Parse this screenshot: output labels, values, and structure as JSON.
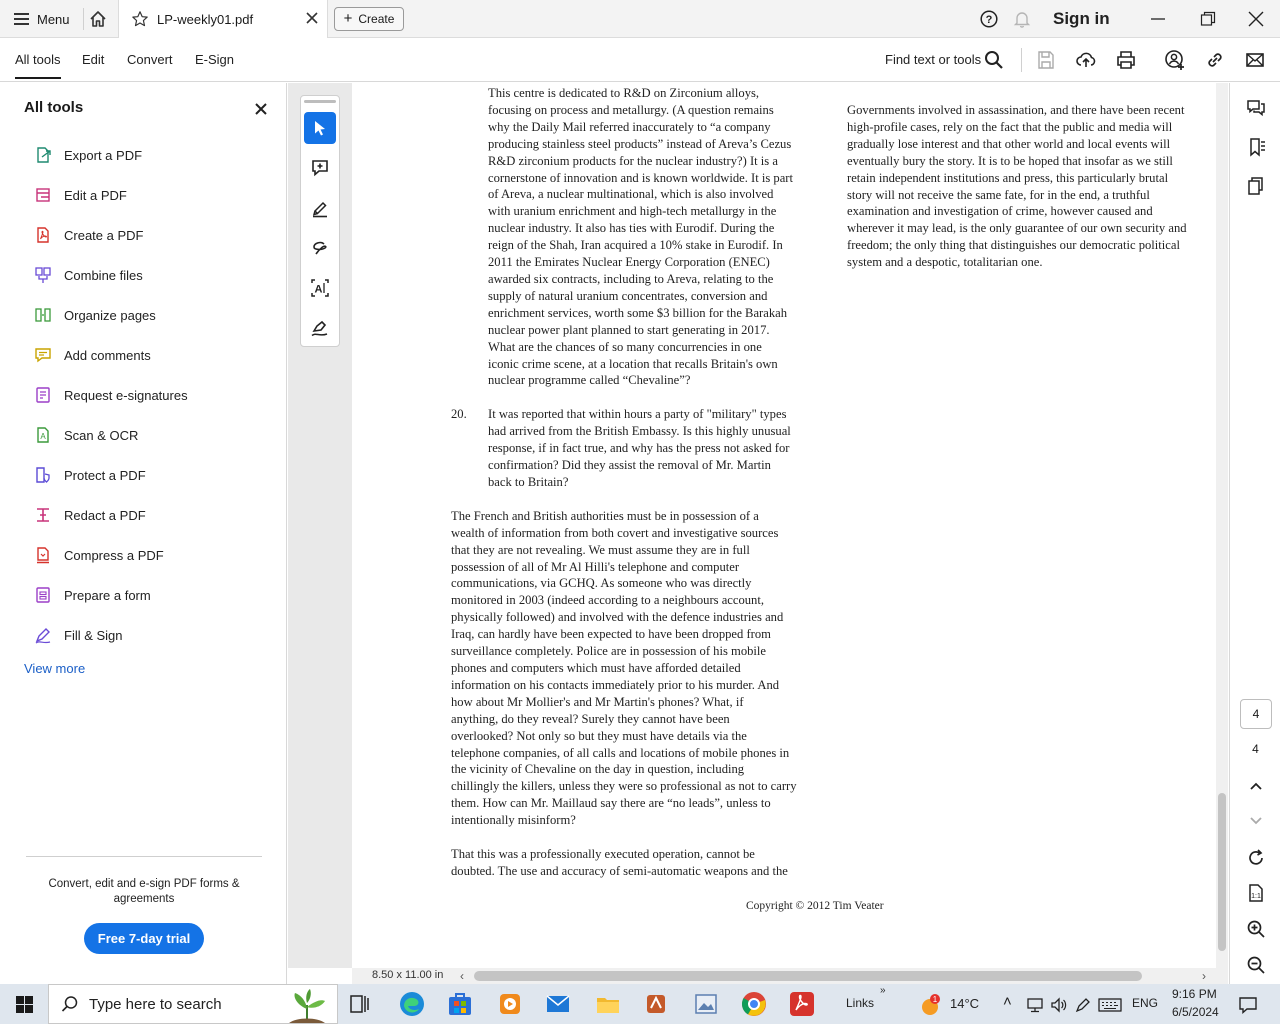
{
  "titlebar": {
    "menu_label": "Menu",
    "tab_label": "LP-weekly01.pdf",
    "create_label": "Create",
    "signin_label": "Sign in"
  },
  "toolbar": {
    "nav": [
      "All tools",
      "Edit",
      "Convert",
      "E-Sign"
    ],
    "find_label": "Find text or tools"
  },
  "leftpanel": {
    "title": "All tools",
    "tools": [
      {
        "label": "Export a PDF",
        "icon": "export-pdf-icon",
        "color": "#1f8a70"
      },
      {
        "label": "Edit a PDF",
        "icon": "edit-pdf-icon",
        "color": "#c8337a"
      },
      {
        "label": "Create a PDF",
        "icon": "create-pdf-icon",
        "color": "#d6332c"
      },
      {
        "label": "Combine files",
        "icon": "combine-files-icon",
        "color": "#6a4bd6"
      },
      {
        "label": "Organize pages",
        "icon": "organize-pages-icon",
        "color": "#3c9a3c"
      },
      {
        "label": "Add comments",
        "icon": "add-comments-icon",
        "color": "#c9a400"
      },
      {
        "label": "Request e-signatures",
        "icon": "request-esignatures-icon",
        "color": "#9b3fc7"
      },
      {
        "label": "Scan & OCR",
        "icon": "scan-ocr-icon",
        "color": "#3c9a3c"
      },
      {
        "label": "Protect a PDF",
        "icon": "protect-pdf-icon",
        "color": "#5b4bd6"
      },
      {
        "label": "Redact a PDF",
        "icon": "redact-pdf-icon",
        "color": "#c8337a"
      },
      {
        "label": "Compress a PDF",
        "icon": "compress-pdf-icon",
        "color": "#d6332c"
      },
      {
        "label": "Prepare a form",
        "icon": "prepare-form-icon",
        "color": "#9b3fc7"
      },
      {
        "label": "Fill & Sign",
        "icon": "fill-sign-icon",
        "color": "#6a4bd6"
      }
    ],
    "view_more": "View more",
    "promo_text": "Convert, edit and e-sign PDF forms & agreements",
    "trial_button": "Free 7-day trial"
  },
  "document": {
    "para1": "This centre is dedicated to R&D on Zirconium alloys,\nfocusing on process and metallurgy. (A question remains\nwhy the Daily Mail referred inaccurately to “a company\nproducing stainless steel products” instead of Areva’s Cezus\nR&D zirconium products for the nuclear industry?)  It is a\ncornerstone of innovation and is known worldwide.  It is part\nof Areva, a nuclear multinational, which is also involved\nwith uranium enrichment and high-tech metallurgy in the\nnuclear industry.  It also has ties with Eurodif.  During the\nreign of the Shah, Iran acquired a 10% stake in Eurodif. In\n2011 the Emirates Nuclear Energy Corporation (ENEC)\nawarded six contracts, including to Areva, relating to the\nsupply of natural uranium concentrates, conversion and\nenrichment services, worth some $3 billion for the Barakah\nnuclear power plant planned to start generating in 2017.\nWhat are the chances of so many concurrencies in one\niconic crime scene, at a location that recalls Britain's own\nnuclear programme called “Chevaline”?",
    "item20_num": "20.",
    "item20_text": "It was reported that within hours a party of \"military\" types\nhad arrived from the British Embassy.  Is this highly unusual\nresponse, if in fact true, and why has the press not asked for\nconfirmation?  Did they assist the removal of Mr. Martin\nback to Britain?",
    "para3": "The French and British authorities must be in possession of a\nwealth of information from both covert and investigative sources\nthat they are not revealing.  We must assume they are in full\npossession of all of Mr Al Hilli's telephone and computer\ncommunications, via GCHQ.  As someone who was directly\nmonitored in 2003 (indeed according to a neighbours account,\nphysically followed) and involved with the defence industries and\nIraq, can hardly have been expected to have been dropped from\nsurveillance completely.  Police are in possession of his mobile\nphones and computers which must have afforded detailed\ninformation on his contacts immediately prior to his murder.  And\nhow about Mr Mollier's and Mr Martin's phones?  What, if\nanything, do they reveal?  Surely they cannot have been\noverlooked?  Not only so but they must have details via the\ntelephone companies, of all calls and locations of mobile phones in\nthe vicinity of Chevaline on the day in question, including\nchillingly the killers, unless they were so professional as not to carry\nthem.  How can Mr. Maillaud say there are “no leads”, unless to\nintentionally misinform?",
    "para4": "That this was a professionally executed operation, cannot be\ndoubted.  The use and accuracy of semi-automatic weapons and the",
    "col2": "Governments involved in assassination, and there have been recent\nhigh-profile cases, rely on the fact that the public and media will\ngradually lose interest and that other world and local events will\neventually bury the story.  It is to be hoped that insofar as we still\nretain independent institutions and press, this particularly brutal\nstory will not receive the same fate, for in the end, a truthful\nexamination and investigation of crime, however caused and\nwherever it may lead, is the only guarantee of our own security and\nfreedom; the only thing that distinguishes our democratic political\nsystem and a despotic, totalitarian one.",
    "copyright": "Copyright © 2012 Tim Veater"
  },
  "statusbar": {
    "page_size": "8.50 x 11.00 in",
    "current_page": "4",
    "total_pages": "4"
  },
  "taskbar": {
    "search_placeholder": "Type here to search",
    "links_label": "Links",
    "weather_temp": "14°C",
    "weather_badge": "1",
    "lang": "ENG",
    "time": "9:16 PM",
    "date": "6/5/2024"
  },
  "colors": {
    "accent": "#1473e6",
    "acrobat_red": "#d6332c"
  }
}
